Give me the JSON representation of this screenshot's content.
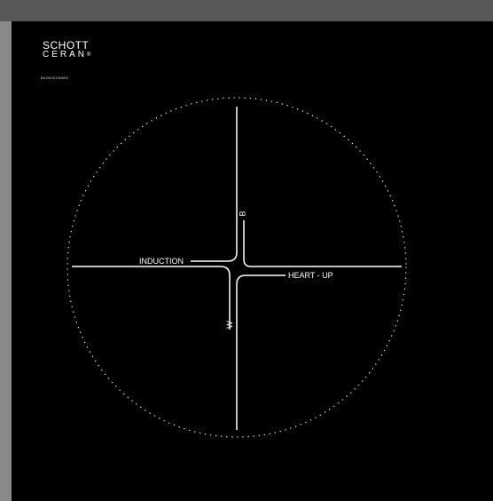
{
  "logo": {
    "line1": "SCHOTT",
    "line2": "CERAN",
    "registered_mark": "®"
  },
  "serial_code": "BAG820190603",
  "labels": {
    "left": "INDUCTION",
    "right": "HEART - UP",
    "top": "B",
    "bottom": "W"
  },
  "colors": {
    "panel_background": "#000000",
    "lines": "#ffffff",
    "frame": "#6e6e6e"
  }
}
